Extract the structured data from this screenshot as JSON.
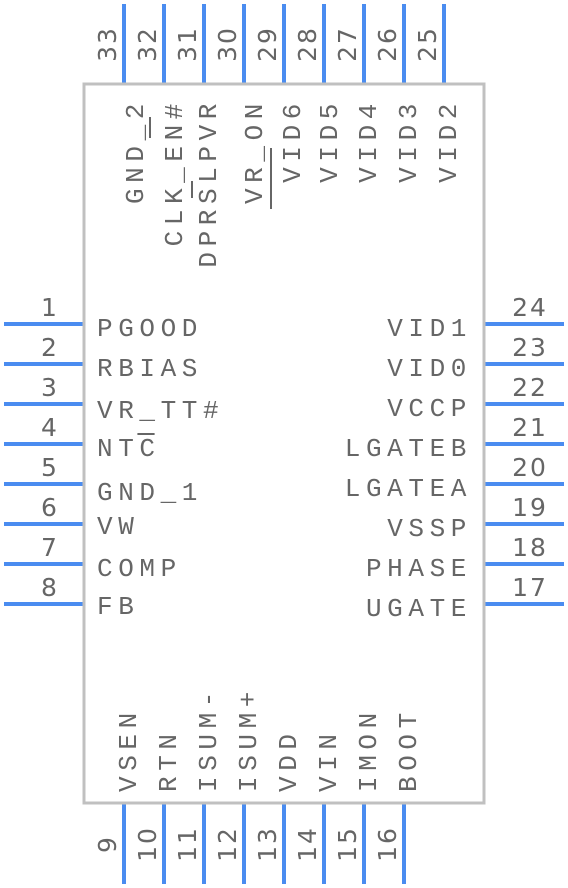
{
  "component": {
    "colors": {
      "pin": "#4a8cf0",
      "body_border": "#c0c0c0",
      "text": "#666666"
    },
    "left_pins": [
      {
        "number": "1",
        "name": "PGOOD"
      },
      {
        "number": "2",
        "name": "RBIAS"
      },
      {
        "number": "3",
        "name": "VR_TT#",
        "overbar": "",
        "underscore_gap": true
      },
      {
        "number": "4",
        "name": "NTC",
        "overbar_chars": "C"
      },
      {
        "number": "5",
        "name": "GND_1"
      },
      {
        "number": "6",
        "name": "VW"
      },
      {
        "number": "7",
        "name": "COMP"
      },
      {
        "number": "8",
        "name": "FB"
      }
    ],
    "right_pins": [
      {
        "number": "24",
        "name": "VID1"
      },
      {
        "number": "23",
        "name": "VID0"
      },
      {
        "number": "22",
        "name": "VCCP"
      },
      {
        "number": "21",
        "name": "LGATEB"
      },
      {
        "number": "20",
        "name": "LGATEA"
      },
      {
        "number": "19",
        "name": "VSSP"
      },
      {
        "number": "18",
        "name": "PHASE"
      },
      {
        "number": "17",
        "name": "UGATE"
      }
    ],
    "top_pins": [
      {
        "number": "33",
        "name": "GND_2"
      },
      {
        "number": "32",
        "name": "CLK_EN#",
        "overbar_chars": "_"
      },
      {
        "number": "31",
        "name": "DPRSLPVR",
        "overbar_chars": "L"
      },
      {
        "number": "30",
        "name": "VR_ON"
      },
      {
        "number": "29",
        "name": "VID6",
        "overbar_chars": "V"
      },
      {
        "number": "28",
        "name": "VID5"
      },
      {
        "number": "27",
        "name": "VID4"
      },
      {
        "number": "26",
        "name": "VID3"
      },
      {
        "number": "25",
        "name": "VID2"
      }
    ],
    "bottom_pins": [
      {
        "number": "9",
        "name": "VSEN"
      },
      {
        "number": "10",
        "name": "RTN"
      },
      {
        "number": "11",
        "name": "ISUM-"
      },
      {
        "number": "12",
        "name": "ISUM+"
      },
      {
        "number": "13",
        "name": "VDD"
      },
      {
        "number": "14",
        "name": "VIN"
      },
      {
        "number": "15",
        "name": "IMON"
      },
      {
        "number": "16",
        "name": "BOOT"
      }
    ]
  }
}
